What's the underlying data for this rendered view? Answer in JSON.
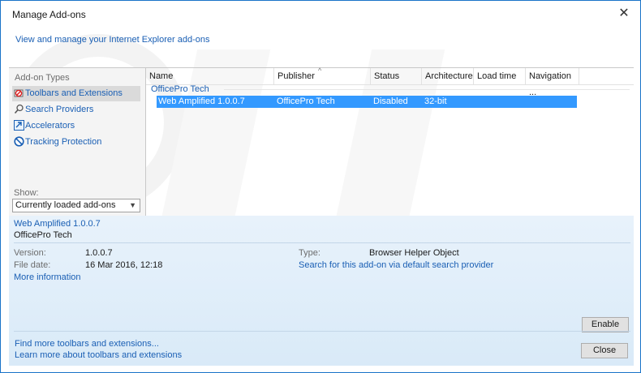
{
  "window": {
    "title": "Manage Add-ons",
    "close_glyph": "✕",
    "subtitle": "View and manage your Internet Explorer add-ons"
  },
  "sidebar": {
    "title": "Add-on Types",
    "items": [
      {
        "label": "Toolbars and Extensions",
        "icon": "toolbars-extensions-icon",
        "selected": true
      },
      {
        "label": "Search Providers",
        "icon": "search-icon",
        "selected": false
      },
      {
        "label": "Accelerators",
        "icon": "accelerators-icon",
        "selected": false
      },
      {
        "label": "Tracking Protection",
        "icon": "tracking-protection-icon",
        "selected": false
      }
    ],
    "show_label": "Show:",
    "show_value": "Currently loaded add-ons"
  },
  "list": {
    "columns": [
      "Name",
      "Publisher",
      "Status",
      "Architecture",
      "Load time",
      "Navigation ..."
    ],
    "group": "OfficePro Tech",
    "rows": [
      {
        "name": "Web Amplified 1.0.0.7",
        "publisher": "OfficePro Tech",
        "status": "Disabled",
        "architecture": "32-bit",
        "load_time": "",
        "navigation": ""
      }
    ]
  },
  "details": {
    "name": "Web Amplified 1.0.0.7",
    "publisher": "OfficePro Tech",
    "version_label": "Version:",
    "version_value": "1.0.0.7",
    "filedate_label": "File date:",
    "filedate_value": "16 Mar 2016, 12:18",
    "more_info": "More information",
    "type_label": "Type:",
    "type_value": "Browser Helper Object",
    "search_link": "Search for this add-on via default search provider",
    "enable_button": "Enable",
    "find_more": "Find more toolbars and extensions...",
    "learn_more": "Learn more about toolbars and extensions",
    "close_button": "Close"
  },
  "colors": {
    "accent": "#1a5fb4",
    "selection": "#3399ff",
    "window_border": "#1a73c8"
  }
}
